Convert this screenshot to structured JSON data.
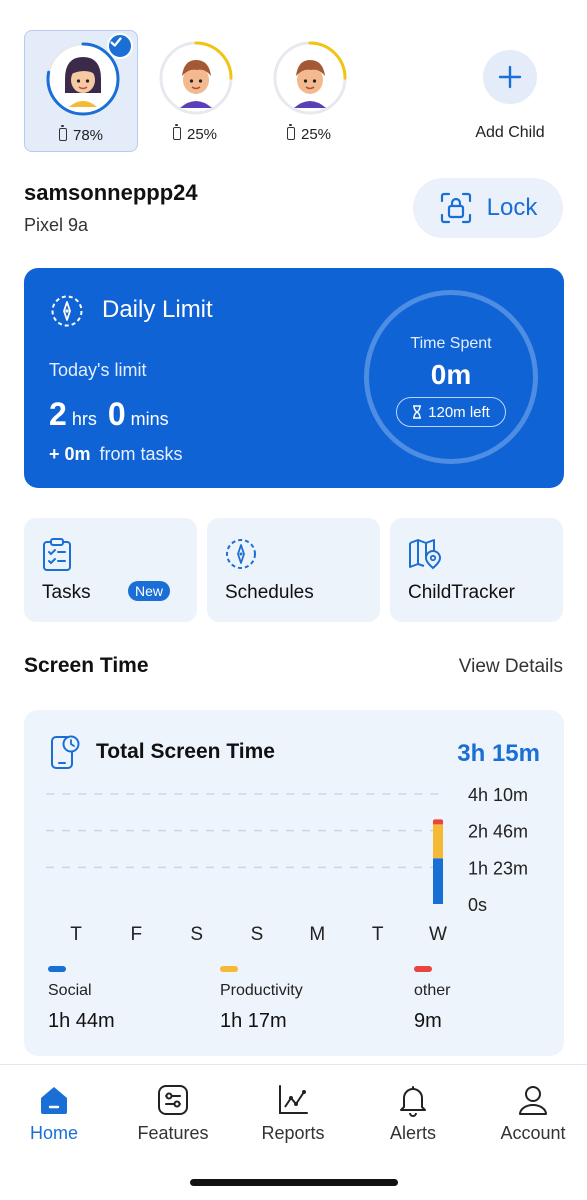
{
  "children": [
    {
      "battery": "78%",
      "selected": true,
      "progress": 0.78,
      "ring_color": "#1a6fd6"
    },
    {
      "battery": "25%",
      "selected": false,
      "progress": 0.25,
      "ring_color": "#f2c40f"
    },
    {
      "battery": "25%",
      "selected": false,
      "progress": 0.25,
      "ring_color": "#f2c40f"
    }
  ],
  "add_child": {
    "label": "Add Child"
  },
  "device": {
    "name": "samsonneppp24",
    "model": "Pixel 9a",
    "lock_label": "Lock"
  },
  "daily_limit": {
    "title": "Daily Limit",
    "todays_limit_label": "Today's limit",
    "hours": "2",
    "hours_unit": "hrs",
    "mins": "0",
    "mins_unit": "mins",
    "tasks_bonus": "+ 0m",
    "tasks_suffix": "from tasks",
    "time_spent_label": "Time Spent",
    "time_spent_value": "0m",
    "time_left": "120m left"
  },
  "features": {
    "tasks_label": "Tasks",
    "tasks_badge": "New",
    "schedules_label": "Schedules",
    "childtracker_label": "ChildTracker"
  },
  "screen_time": {
    "section_title": "Screen Time",
    "view_details": "View Details",
    "card_title": "Total Screen Time",
    "total": "3h 15m"
  },
  "chart_data": {
    "type": "bar",
    "categories": [
      "T",
      "F",
      "S",
      "S",
      "M",
      "T",
      "W"
    ],
    "y_tick_labels": [
      "4h 10m",
      "2h 46m",
      "1h 23m",
      "0s"
    ],
    "ylim": [
      0,
      250
    ],
    "series": [
      {
        "name": "Social",
        "color": "#1a6fd6",
        "values": [
          0,
          0,
          0,
          0,
          0,
          0,
          104
        ]
      },
      {
        "name": "Productivity",
        "color": "#f5b935",
        "values": [
          0,
          0,
          0,
          0,
          0,
          0,
          77
        ]
      },
      {
        "name": "other",
        "color": "#e8453c",
        "values": [
          0,
          0,
          0,
          0,
          0,
          0,
          9
        ]
      }
    ],
    "stacked": true,
    "grid": true
  },
  "legend": [
    {
      "name": "Social",
      "value": "1h 44m",
      "color": "#1a6fd6"
    },
    {
      "name": "Productivity",
      "value": "1h 17m",
      "color": "#f5b935"
    },
    {
      "name": "other",
      "value": "9m",
      "color": "#e8453c"
    }
  ],
  "nav": {
    "home": "Home",
    "features": "Features",
    "reports": "Reports",
    "alerts": "Alerts",
    "account": "Account"
  }
}
